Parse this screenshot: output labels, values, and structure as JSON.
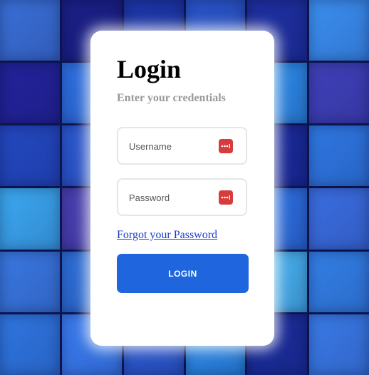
{
  "login": {
    "title": "Login",
    "subtitle": "Enter your credentials",
    "username_placeholder": "Username",
    "password_placeholder": "Password",
    "forgot_link": "Forgot your Password",
    "login_button": "LOGIN"
  },
  "colors": {
    "accent": "#1f66de",
    "link": "#1a3ccf",
    "password_manager_icon": "#d83b3b",
    "subtitle": "#9a9a9a"
  },
  "icons": {
    "field_icon": "password-manager-icon"
  },
  "background": {
    "tiles": [
      "#3a6fd6",
      "#1b1f86",
      "#1d36a8",
      "#2a55c8",
      "#1e2fa0",
      "#3b8ff0",
      "#23229a",
      "#2d6fe0",
      "#1c3db3",
      "#3a9bf2",
      "#2d8be8",
      "#4040b8",
      "#2348c0",
      "#2b57cf",
      "#1e1f88",
      "#2e7fe2",
      "#1a2a9a",
      "#2f78e2",
      "#3ca8f0",
      "#4a3fb0",
      "#3568d8",
      "#1a3aa8",
      "#2d6fe0",
      "#3b6ee0",
      "#3a78e0",
      "#2d6fd8",
      "#3f64d6",
      "#1a1b7a",
      "#48b4f0",
      "#3380e6",
      "#2f76e0",
      "#3a7cf0",
      "#2c5ad0",
      "#2b8ae8",
      "#1a2c9a",
      "#3a7ae6"
    ]
  }
}
